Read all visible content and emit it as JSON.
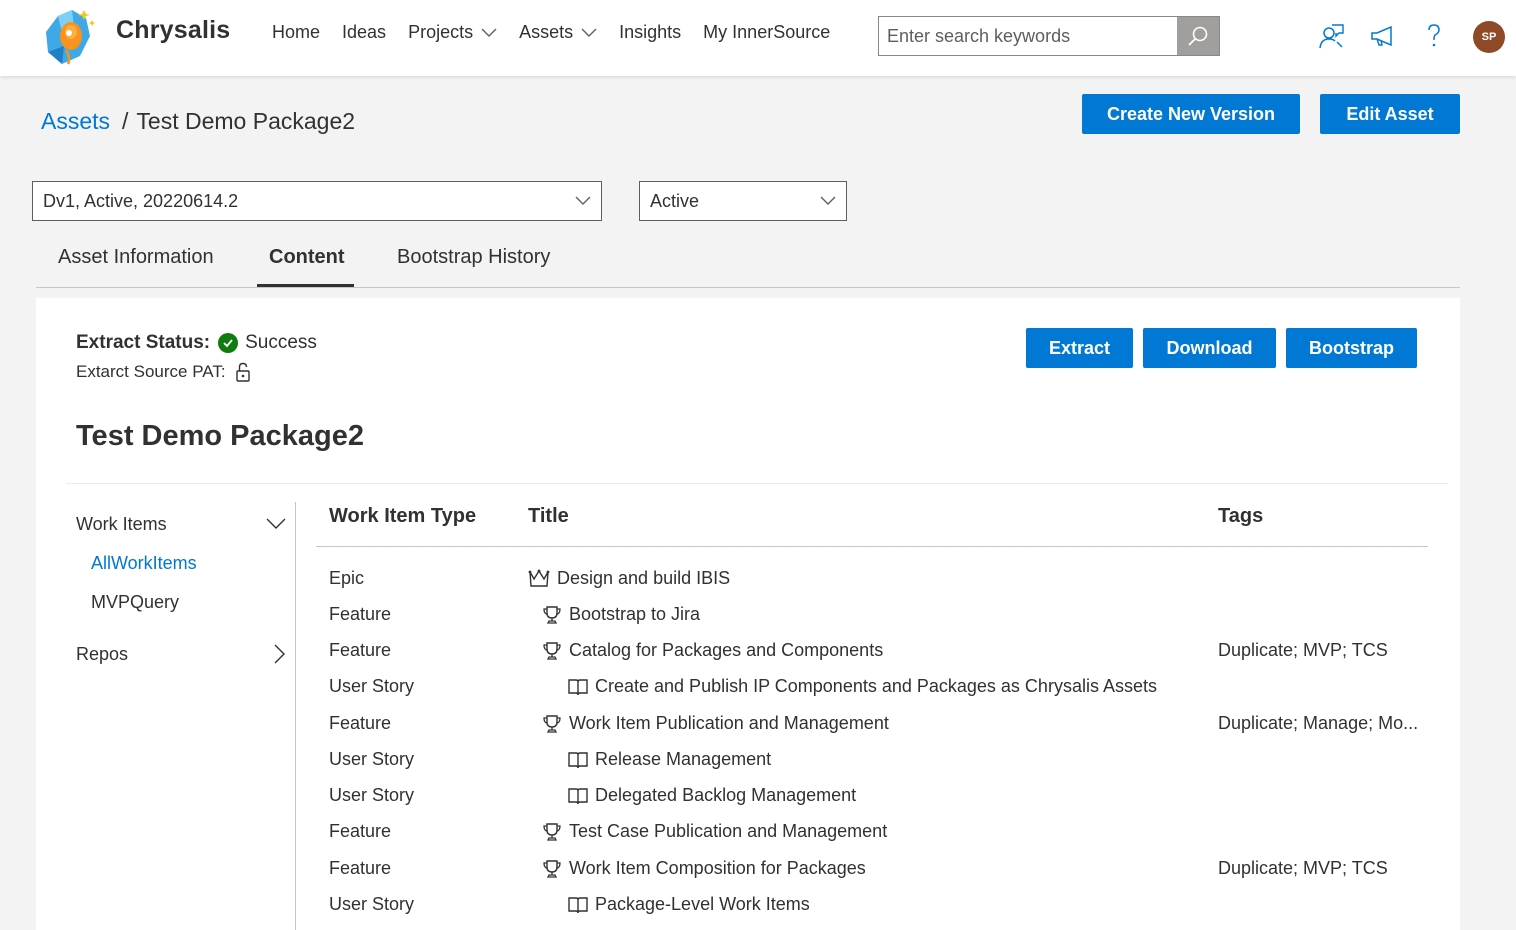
{
  "app": {
    "name": "Chrysalis",
    "nav": [
      {
        "label": "Home"
      },
      {
        "label": "Ideas"
      },
      {
        "label": "Projects"
      },
      {
        "label": "Assets"
      },
      {
        "label": "Insights"
      },
      {
        "label": "My InnerSource"
      }
    ],
    "search_placeholder": "Enter search keywords",
    "avatar_initials": "SP"
  },
  "breadcrumb": {
    "parent": "Assets",
    "separator": "/",
    "current": "Test Demo Package2"
  },
  "actions": {
    "create_version": "Create New Version",
    "edit_asset": "Edit Asset"
  },
  "filters": {
    "version_value": "Dv1, Active, 20220614.2",
    "state_value": "Active"
  },
  "tabs": [
    {
      "label": "Asset Information"
    },
    {
      "label": "Content"
    },
    {
      "label": "Bootstrap History"
    }
  ],
  "content": {
    "extract_status_label": "Extract Status:",
    "extract_status_value": "Success",
    "extract_pat_label": "Extarct Source PAT:",
    "buttons": {
      "extract": "Extract",
      "download": "Download",
      "bootstrap": "Bootstrap"
    },
    "package_title": "Test Demo Package2"
  },
  "sidebar": {
    "work_items_label": "Work Items",
    "queries": [
      {
        "label": "AllWorkItems"
      },
      {
        "label": "MVPQuery"
      }
    ],
    "repos_label": "Repos"
  },
  "table": {
    "headers": {
      "type": "Work Item Type",
      "title": "Title",
      "tags": "Tags"
    },
    "rows": [
      {
        "type": "Epic",
        "title": "Design and build IBIS",
        "tags": "",
        "icon": "crown-icon"
      },
      {
        "type": "Feature",
        "title": "Bootstrap to Jira",
        "tags": "",
        "icon": "trophy-icon"
      },
      {
        "type": "Feature",
        "title": "Catalog for Packages and Components",
        "tags": "Duplicate; MVP; TCS",
        "icon": "trophy-icon"
      },
      {
        "type": "User Story",
        "title": "Create and Publish IP Components and Packages as Chrysalis Assets",
        "tags": "",
        "icon": "book-icon"
      },
      {
        "type": "Feature",
        "title": "Work Item Publication and Management",
        "tags": "Duplicate; Manage; Mo...",
        "icon": "trophy-icon"
      },
      {
        "type": "User Story",
        "title": "Release Management",
        "tags": "",
        "icon": "book-icon"
      },
      {
        "type": "User Story",
        "title": "Delegated Backlog Management",
        "tags": "",
        "icon": "book-icon"
      },
      {
        "type": "Feature",
        "title": "Test Case Publication and Management",
        "tags": "",
        "icon": "trophy-icon"
      },
      {
        "type": "Feature",
        "title": "Work Item Composition for Packages",
        "tags": "Duplicate; MVP; TCS",
        "icon": "trophy-icon"
      },
      {
        "type": "User Story",
        "title": "Package-Level Work Items",
        "tags": "",
        "icon": "book-icon"
      }
    ]
  },
  "colors": {
    "primary": "#0078d4",
    "success": "#107c10",
    "avatar": "#8e4a26"
  }
}
